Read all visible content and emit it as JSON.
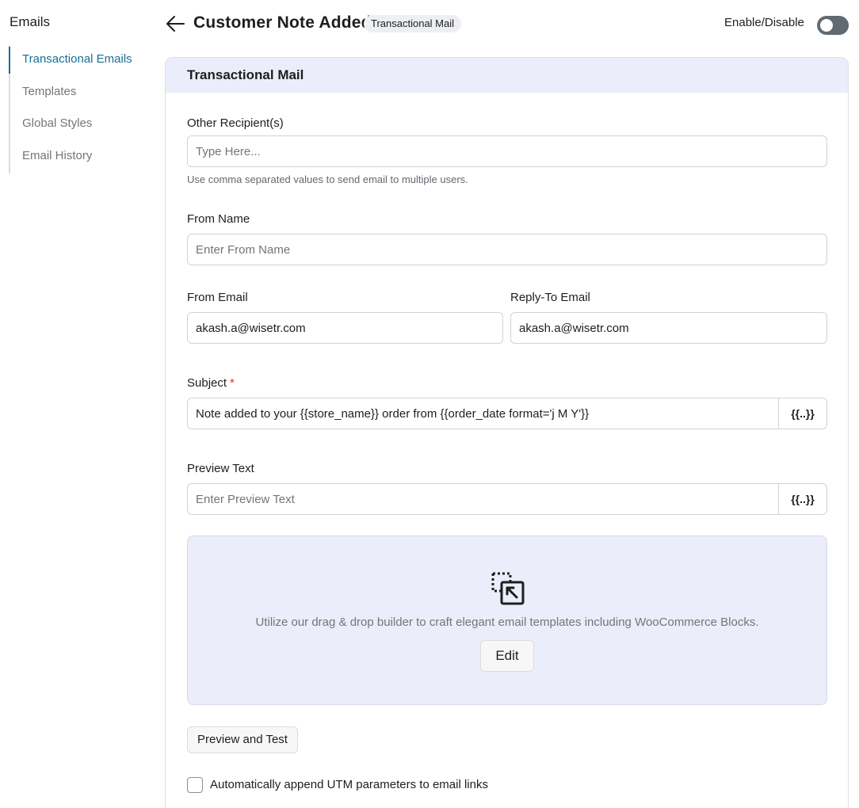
{
  "sidebar": {
    "title": "Emails",
    "items": [
      {
        "label": "Transactional Emails",
        "active": true
      },
      {
        "label": "Templates",
        "active": false
      },
      {
        "label": "Global Styles",
        "active": false
      },
      {
        "label": "Email History",
        "active": false
      }
    ]
  },
  "header": {
    "back_icon": "arrow-left-icon",
    "title": "Customer Note Added",
    "badge": "Transactional Mail",
    "toggle_label": "Enable/Disable",
    "toggle_state": "off"
  },
  "card": {
    "title": "Transactional Mail",
    "other_recipients": {
      "label": "Other Recipient(s)",
      "value": "",
      "placeholder": "Type Here...",
      "help": "Use comma separated values to send email to multiple users."
    },
    "from_name": {
      "label": "From Name",
      "value": "",
      "placeholder": "Enter From Name"
    },
    "from_email": {
      "label": "From Email",
      "value": "akash.a@wisetr.com"
    },
    "reply_to_email": {
      "label": "Reply-To Email",
      "value": "akash.a@wisetr.com"
    },
    "subject": {
      "label": "Subject",
      "required_mark": "*",
      "value": "Note added to your {{store_name}} order from {{order_date format='j M Y'}}",
      "tag_button": "{{..}}"
    },
    "preview_text": {
      "label": "Preview Text",
      "value": "",
      "placeholder": "Enter Preview Text",
      "tag_button": "{{..}}"
    },
    "builder": {
      "icon": "drag-drop-select-icon",
      "text": "Utilize our drag & drop builder to craft elegant email templates including WooCommerce Blocks.",
      "edit_label": "Edit"
    },
    "preview_button": "Preview and Test",
    "utm_checkbox": {
      "label": "Automatically append UTM parameters to email links",
      "checked": false
    }
  },
  "colors": {
    "accent": "#1a6e96",
    "header_bg": "#ebedfa",
    "toggle_off": "#606a73",
    "required": "#d63638"
  }
}
